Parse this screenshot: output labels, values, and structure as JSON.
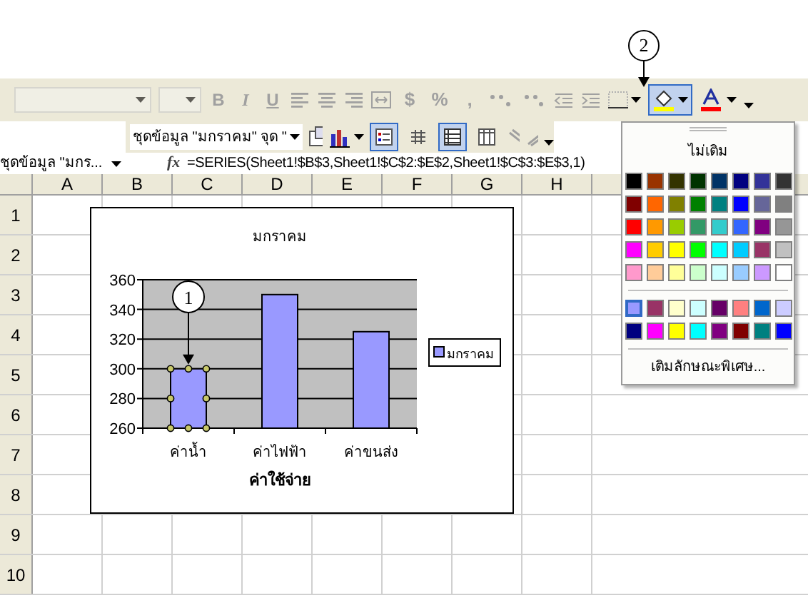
{
  "callout_top": {
    "text": "2"
  },
  "formatting_toolbar": {
    "buttons": [
      "B",
      "I",
      "U",
      "$",
      "%",
      ","
    ],
    "fill_color_open": true
  },
  "chart_toolbar": {
    "object_select": "ชุดข้อมูล \"มกราคม\" จุด \"",
    "toggles": [
      {
        "kind": "legend",
        "on": true
      },
      {
        "kind": "data_table",
        "on": false
      },
      {
        "kind": "by_row",
        "on": true
      },
      {
        "kind": "by_column",
        "on": false
      }
    ]
  },
  "formula_bar": {
    "name_box": "ชุดข้อมูล \"มกร...",
    "fx": "fx",
    "formula": "=SERIES(Sheet1!$B$3,Sheet1!$C$2:$E$2,Sheet1!$C$3:$E$3,1)"
  },
  "columns": [
    "A",
    "B",
    "C",
    "D",
    "E",
    "F",
    "G",
    "H"
  ],
  "rows": [
    "1",
    "2",
    "3",
    "4",
    "5",
    "6",
    "7",
    "8",
    "9",
    "10"
  ],
  "chart": {
    "chart_data": {
      "type": "bar",
      "title": "มกราคม",
      "xlabel": "ค่าใช้จ่าย",
      "categories": [
        "ค่าน้ำ",
        "ค่าไฟฟ้า",
        "ค่าขนส่ง"
      ],
      "series": [
        {
          "name": "มกราคม",
          "color": "#9999ff",
          "values": [
            300,
            350,
            325
          ]
        }
      ],
      "ylim": [
        260,
        360
      ],
      "yticks": [
        260,
        280,
        300,
        320,
        340,
        360
      ],
      "grid": true,
      "annotations": [
        {
          "text": "1",
          "x": "ค่าน้ำ"
        }
      ]
    }
  },
  "fill_color_menu": {
    "no_fill": "ไม่เติม",
    "swatch_rows": [
      [
        {
          "color": "#000000",
          "selected": false
        },
        {
          "color": "#993300",
          "selected": false
        },
        {
          "color": "#333300",
          "selected": false
        },
        {
          "color": "#003300",
          "selected": false
        },
        {
          "color": "#003366",
          "selected": false
        },
        {
          "color": "#000080",
          "selected": false
        },
        {
          "color": "#333399",
          "selected": false
        },
        {
          "color": "#333333",
          "selected": false
        }
      ],
      [
        {
          "color": "#800000",
          "selected": false
        },
        {
          "color": "#ff6600",
          "selected": false
        },
        {
          "color": "#808000",
          "selected": false
        },
        {
          "color": "#008000",
          "selected": false
        },
        {
          "color": "#008080",
          "selected": false
        },
        {
          "color": "#0000ff",
          "selected": false
        },
        {
          "color": "#666699",
          "selected": false
        },
        {
          "color": "#808080",
          "selected": false
        }
      ],
      [
        {
          "color": "#ff0000",
          "selected": false
        },
        {
          "color": "#ff9900",
          "selected": false
        },
        {
          "color": "#99cc00",
          "selected": false
        },
        {
          "color": "#339966",
          "selected": false
        },
        {
          "color": "#33cccc",
          "selected": false
        },
        {
          "color": "#3366ff",
          "selected": false
        },
        {
          "color": "#800080",
          "selected": false
        },
        {
          "color": "#969696",
          "selected": false
        }
      ],
      [
        {
          "color": "#ff00ff",
          "selected": false
        },
        {
          "color": "#ffcc00",
          "selected": false
        },
        {
          "color": "#ffff00",
          "selected": false
        },
        {
          "color": "#00ff00",
          "selected": false
        },
        {
          "color": "#00ffff",
          "selected": false
        },
        {
          "color": "#00ccff",
          "selected": false
        },
        {
          "color": "#993366",
          "selected": false
        },
        {
          "color": "#c0c0c0",
          "selected": false
        }
      ],
      [
        {
          "color": "#ff99cc",
          "selected": false
        },
        {
          "color": "#ffcc99",
          "selected": false
        },
        {
          "color": "#ffff99",
          "selected": false
        },
        {
          "color": "#ccffcc",
          "selected": false
        },
        {
          "color": "#ccffff",
          "selected": false
        },
        {
          "color": "#99ccff",
          "selected": false
        },
        {
          "color": "#cc99ff",
          "selected": false
        },
        {
          "color": "#ffffff",
          "selected": false
        }
      ]
    ],
    "chart_swatch_rows": [
      [
        {
          "color": "#9999ff",
          "selected": true
        },
        {
          "color": "#993366",
          "selected": false
        },
        {
          "color": "#ffffcc",
          "selected": false
        },
        {
          "color": "#ccffff",
          "selected": false
        },
        {
          "color": "#660066",
          "selected": false
        },
        {
          "color": "#ff8080",
          "selected": false
        },
        {
          "color": "#0066cc",
          "selected": false
        },
        {
          "color": "#ccccff",
          "selected": false
        }
      ],
      [
        {
          "color": "#000080",
          "selected": false
        },
        {
          "color": "#ff00ff",
          "selected": false
        },
        {
          "color": "#ffff00",
          "selected": false
        },
        {
          "color": "#00ffff",
          "selected": false
        },
        {
          "color": "#800080",
          "selected": false
        },
        {
          "color": "#800000",
          "selected": false
        },
        {
          "color": "#008080",
          "selected": false
        },
        {
          "color": "#0000ff",
          "selected": false
        }
      ]
    ],
    "fill_effects": "เติมลักษณะพิเศษ..."
  }
}
